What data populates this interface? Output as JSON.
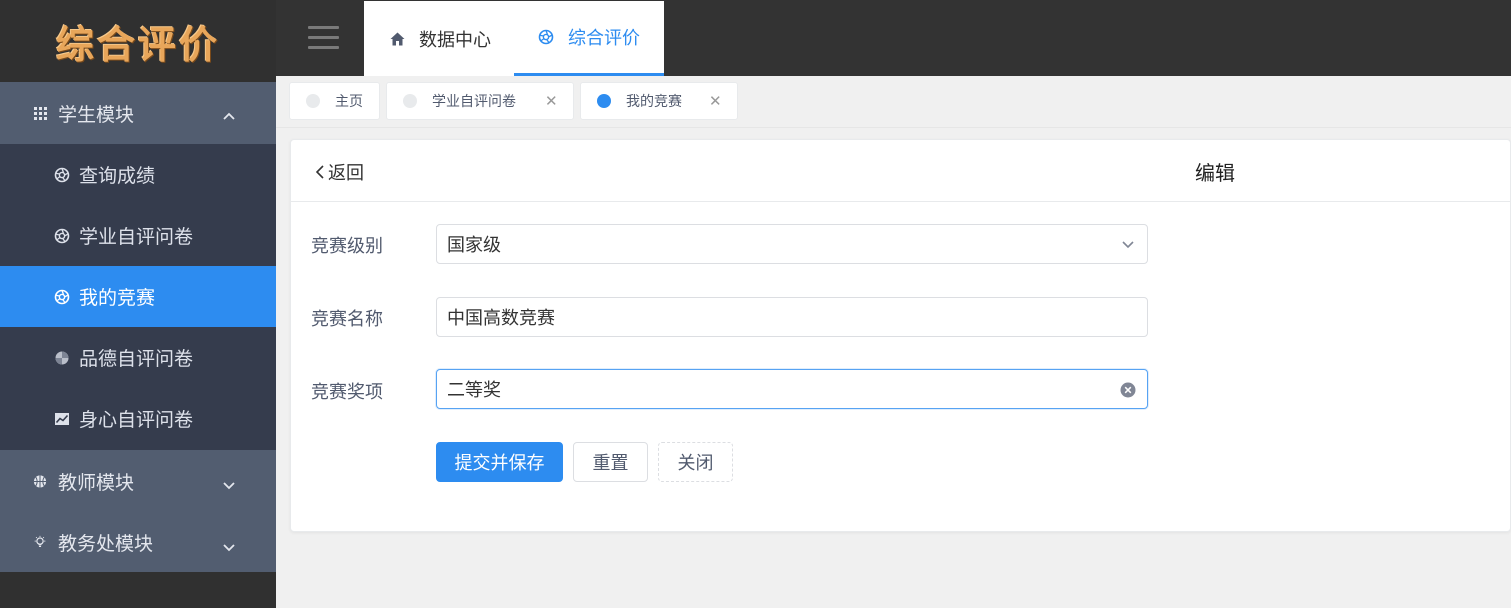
{
  "app": {
    "logo_text": "综合评价"
  },
  "sidebar": {
    "groups": [
      {
        "label": "学生模块",
        "icon": "grid-icon",
        "expanded": true
      },
      {
        "label": "教师模块",
        "icon": "basketball-icon",
        "expanded": false
      },
      {
        "label": "教务处模块",
        "icon": "bulb-icon",
        "expanded": false
      }
    ],
    "student_items": [
      {
        "label": "查询成绩",
        "icon": "aperture-icon"
      },
      {
        "label": "学业自评问卷",
        "icon": "aperture-icon"
      },
      {
        "label": "我的竞赛",
        "icon": "aperture-icon",
        "active": true
      },
      {
        "label": "品德自评问卷",
        "icon": "pinwheel-icon"
      },
      {
        "label": "身心自评问卷",
        "icon": "chart-icon"
      }
    ]
  },
  "header": {
    "tabs": [
      {
        "label": "数据中心",
        "icon": "home-icon"
      },
      {
        "label": "综合评价",
        "icon": "aperture-icon",
        "active": true
      }
    ]
  },
  "tagbar": {
    "tags": [
      {
        "label": "主页",
        "closable": false
      },
      {
        "label": "学业自评问卷",
        "closable": true
      },
      {
        "label": "我的竞赛",
        "closable": true,
        "active": true
      }
    ]
  },
  "form": {
    "back_label": "返回",
    "title": "编辑",
    "fields": [
      {
        "label": "竞赛级别",
        "value": "国家级",
        "type": "select"
      },
      {
        "label": "竞赛名称",
        "value": "中国高数竞赛",
        "type": "input"
      },
      {
        "label": "竞赛奖项",
        "value": "二等奖",
        "type": "input",
        "focused": true
      }
    ],
    "buttons": {
      "submit": "提交并保存",
      "reset": "重置",
      "close": "关闭"
    }
  },
  "colors": {
    "primary": "#2d8cf0",
    "sidebar_bg": "#303030",
    "group_bg": "#525d70",
    "submenu_bg": "#353c4d",
    "logo": "#e8a65a"
  }
}
